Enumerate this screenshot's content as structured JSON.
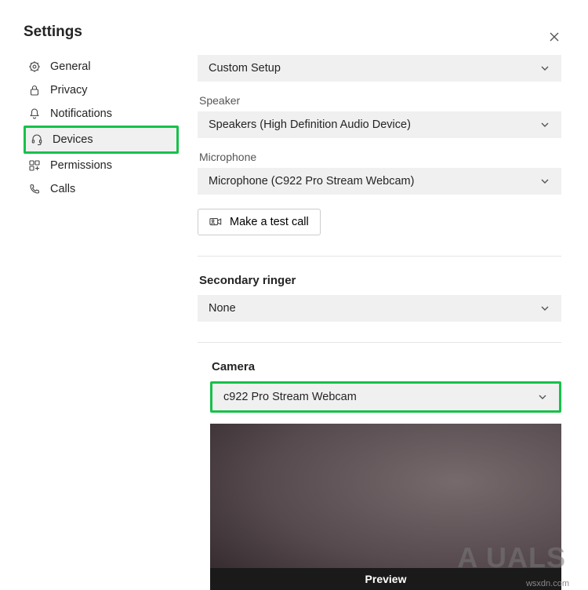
{
  "title": "Settings",
  "sidebar": {
    "items": [
      {
        "label": "General"
      },
      {
        "label": "Privacy"
      },
      {
        "label": "Notifications"
      },
      {
        "label": "Devices"
      },
      {
        "label": "Permissions"
      },
      {
        "label": "Calls"
      }
    ]
  },
  "devices": {
    "setup_value": "Custom Setup",
    "speaker_label": "Speaker",
    "speaker_value": "Speakers (High Definition Audio Device)",
    "microphone_label": "Microphone",
    "microphone_value": "Microphone (C922 Pro Stream Webcam)",
    "test_call_label": "Make a test call",
    "secondary_label": "Secondary ringer",
    "secondary_value": "None",
    "camera_label": "Camera",
    "camera_value": "c922 Pro Stream Webcam",
    "preview_label": "Preview"
  },
  "watermark": "A   UALS",
  "source": "wsxdn.com"
}
